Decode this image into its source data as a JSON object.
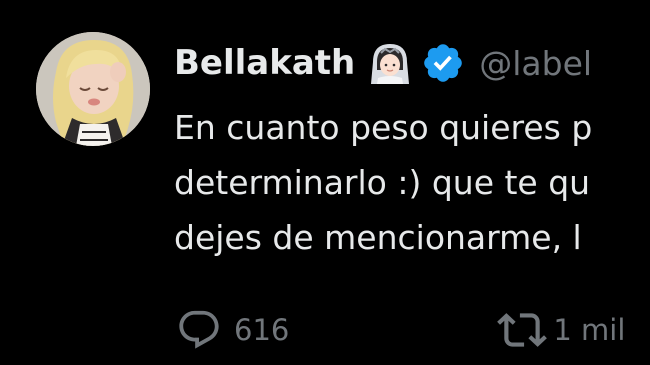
{
  "tweet": {
    "author": {
      "display_name": "Bellakath",
      "name_emoji": "bride-emoji",
      "verified_badge": "verified-checkmark-icon",
      "handle": "@label"
    },
    "text_lines": [
      "En cuanto peso quieres p",
      "determinarlo :) que te qu",
      "dejes de mencionarme, l"
    ],
    "actions": {
      "reply": {
        "icon": "reply-bubble-icon",
        "count": "616"
      },
      "retweet": {
        "icon": "retweet-icon",
        "count": "1 mil"
      }
    },
    "colors": {
      "background": "#000000",
      "primary_text": "#e7e9ea",
      "secondary_text": "#71767b",
      "verified_blue": "#1d9bf0"
    }
  }
}
